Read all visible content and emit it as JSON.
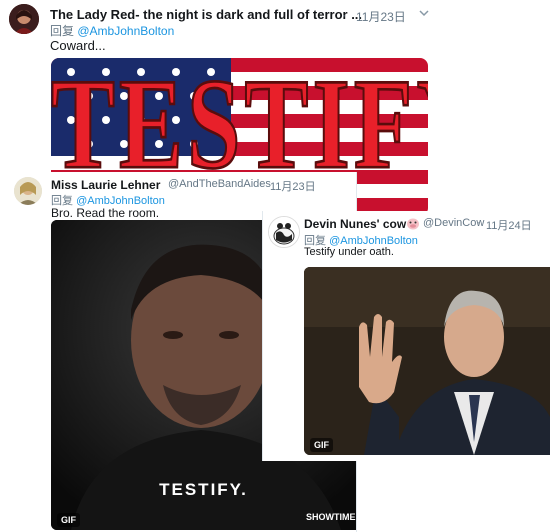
{
  "tweet1": {
    "name": "The Lady Red- the night is dark and full of terror ...",
    "sep": "·",
    "date": "11月23日",
    "reply_label": "回复",
    "reply_handle": "@AmbJohnBolton",
    "text": "Coward...",
    "image_text": "TESTIFY!"
  },
  "tweet2": {
    "name": "Miss Laurie Lehner",
    "handle": "@AndTheBandAides",
    "sep": "·",
    "date": "11月23日",
    "reply_label": "回复",
    "reply_handle": "@AmbJohnBolton",
    "text": "Bro. Read the room.",
    "gif_caption": "TESTIFY.",
    "gif_badge": "GIF",
    "watermark": "SHOWTIME"
  },
  "tweet3": {
    "name": "Devin Nunes' cow",
    "handle": "@DevinCow",
    "sep": "·",
    "date": "11月24日",
    "reply_label": "回复",
    "reply_handle": "@AmbJohnBolton",
    "text": "Testify under oath.",
    "gif_badge": "GIF"
  },
  "icons": {
    "caret": "chevron-down-icon",
    "cow": "cow-emoji-icon"
  }
}
